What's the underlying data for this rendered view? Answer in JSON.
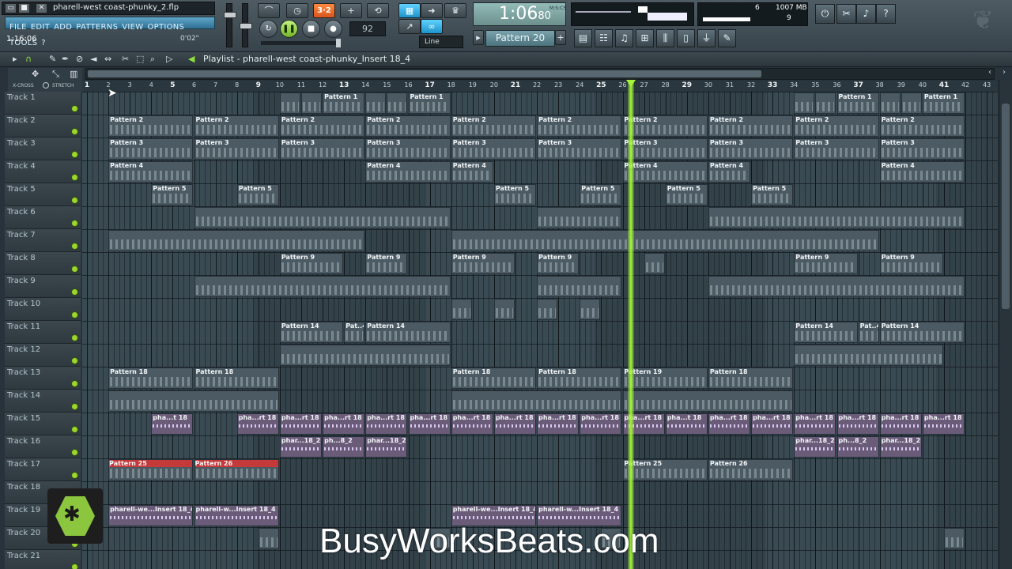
{
  "window": {
    "project_title": "pharell-west coast-phunky_2.flp",
    "menu": [
      "FILE",
      "EDIT",
      "ADD",
      "PATTERNS",
      "VIEW",
      "OPTIONS",
      "TOOLS",
      "?"
    ],
    "time_position": "1:16:06",
    "time_elapsed": "0'02\""
  },
  "transport": {
    "pat_song_label": "",
    "tempo": "92.000",
    "tempo_display": "92",
    "time_display": "1:06",
    "time_display_sub": "80",
    "time_format_label": "M:S:CS",
    "snap_mode": "Line",
    "current_pattern": "Pattern 20",
    "cpu_value": "6",
    "memory_value": "1007 MB",
    "polyphony_value": "9"
  },
  "playlist": {
    "title": "Playlist - pharell-west coast-phunky_Insert 18_4",
    "xcross_label": "X-CROSS",
    "stretch_label": "STRETCH",
    "ruler": [
      "1",
      "2",
      "3",
      "4",
      "5",
      "6",
      "7",
      "8",
      "9",
      "10",
      "11",
      "12",
      "13",
      "14",
      "15",
      "16",
      "17",
      "18",
      "19",
      "20",
      "21",
      "22",
      "23",
      "24",
      "25",
      "26",
      "27",
      "28",
      "29",
      "30",
      "31",
      "32",
      "33",
      "34",
      "35",
      "36",
      "37",
      "38",
      "39",
      "40",
      "41",
      "42",
      "43"
    ],
    "tracks": [
      "Track 1",
      "Track 2",
      "Track 3",
      "Track 4",
      "Track 5",
      "Track 6",
      "Track 7",
      "Track 8",
      "Track 9",
      "Track 10",
      "Track 11",
      "Track 12",
      "Track 13",
      "Track 14",
      "Track 15",
      "Track 16",
      "Track 17",
      "Track 18",
      "Track 19",
      "Track 20",
      "Track 21"
    ],
    "clips": [
      {
        "track": 0,
        "start": 10,
        "len": 1,
        "label": ""
      },
      {
        "track": 0,
        "start": 11,
        "len": 1,
        "label": ""
      },
      {
        "track": 0,
        "start": 12,
        "len": 2,
        "label": "Pattern 1"
      },
      {
        "track": 0,
        "start": 14,
        "len": 1,
        "label": ""
      },
      {
        "track": 0,
        "start": 15,
        "len": 1,
        "label": ""
      },
      {
        "track": 0,
        "start": 16,
        "len": 2,
        "label": "Pattern 1"
      },
      {
        "track": 0,
        "start": 34,
        "len": 1,
        "label": ""
      },
      {
        "track": 0,
        "start": 35,
        "len": 1,
        "label": ""
      },
      {
        "track": 0,
        "start": 36,
        "len": 2,
        "label": "Pattern 1"
      },
      {
        "track": 0,
        "start": 38,
        "len": 1,
        "label": ""
      },
      {
        "track": 0,
        "start": 39,
        "len": 1,
        "label": ""
      },
      {
        "track": 0,
        "start": 40,
        "len": 2,
        "label": "Pattern 1"
      },
      {
        "track": 1,
        "start": 2,
        "len": 4,
        "label": "Pattern 2"
      },
      {
        "track": 1,
        "start": 6,
        "len": 4,
        "label": "Pattern 2"
      },
      {
        "track": 1,
        "start": 10,
        "len": 4,
        "label": "Pattern 2"
      },
      {
        "track": 1,
        "start": 14,
        "len": 4,
        "label": "Pattern 2"
      },
      {
        "track": 1,
        "start": 18,
        "len": 4,
        "label": "Pattern 2"
      },
      {
        "track": 1,
        "start": 22,
        "len": 4,
        "label": "Pattern 2"
      },
      {
        "track": 1,
        "start": 26,
        "len": 4,
        "label": "Pattern 2"
      },
      {
        "track": 1,
        "start": 30,
        "len": 4,
        "label": "Pattern 2"
      },
      {
        "track": 1,
        "start": 34,
        "len": 4,
        "label": "Pattern 2"
      },
      {
        "track": 1,
        "start": 38,
        "len": 4,
        "label": "Pattern 2"
      },
      {
        "track": 2,
        "start": 2,
        "len": 4,
        "label": "Pattern 3"
      },
      {
        "track": 2,
        "start": 6,
        "len": 4,
        "label": "Pattern 3"
      },
      {
        "track": 2,
        "start": 10,
        "len": 4,
        "label": "Pattern 3"
      },
      {
        "track": 2,
        "start": 14,
        "len": 4,
        "label": "Pattern 3"
      },
      {
        "track": 2,
        "start": 18,
        "len": 4,
        "label": "Pattern 3"
      },
      {
        "track": 2,
        "start": 22,
        "len": 4,
        "label": "Pattern 3"
      },
      {
        "track": 2,
        "start": 26,
        "len": 4,
        "label": "Pattern 3"
      },
      {
        "track": 2,
        "start": 30,
        "len": 4,
        "label": "Pattern 3"
      },
      {
        "track": 2,
        "start": 34,
        "len": 4,
        "label": "Pattern 3"
      },
      {
        "track": 2,
        "start": 38,
        "len": 4,
        "label": "Pattern 3"
      },
      {
        "track": 3,
        "start": 2,
        "len": 4,
        "label": "Pattern 4"
      },
      {
        "track": 3,
        "start": 14,
        "len": 4,
        "label": "Pattern 4"
      },
      {
        "track": 3,
        "start": 18,
        "len": 2,
        "label": "Pattern 4"
      },
      {
        "track": 3,
        "start": 26,
        "len": 4,
        "label": "Pattern 4"
      },
      {
        "track": 3,
        "start": 30,
        "len": 2,
        "label": "Pattern 4"
      },
      {
        "track": 3,
        "start": 38,
        "len": 4,
        "label": "Pattern 4"
      },
      {
        "track": 4,
        "start": 4,
        "len": 2,
        "label": "Pattern 5"
      },
      {
        "track": 4,
        "start": 8,
        "len": 2,
        "label": "Pattern 5"
      },
      {
        "track": 4,
        "start": 20,
        "len": 2,
        "label": "Pattern 5"
      },
      {
        "track": 4,
        "start": 24,
        "len": 2,
        "label": "Pattern 5"
      },
      {
        "track": 4,
        "start": 28,
        "len": 2,
        "label": "Pattern 5"
      },
      {
        "track": 4,
        "start": 32,
        "len": 2,
        "label": "Pattern 5"
      },
      {
        "track": 5,
        "start": 6,
        "len": 12,
        "label": ""
      },
      {
        "track": 5,
        "start": 22,
        "len": 4,
        "label": ""
      },
      {
        "track": 5,
        "start": 30,
        "len": 12,
        "label": ""
      },
      {
        "track": 6,
        "start": 2,
        "len": 12,
        "label": ""
      },
      {
        "track": 6,
        "start": 18,
        "len": 20,
        "label": ""
      },
      {
        "track": 7,
        "start": 10,
        "len": 3,
        "label": "Pattern 9"
      },
      {
        "track": 7,
        "start": 14,
        "len": 2,
        "label": "Pattern 9"
      },
      {
        "track": 7,
        "start": 18,
        "len": 3,
        "label": "Pattern 9"
      },
      {
        "track": 7,
        "start": 22,
        "len": 2,
        "label": "Pattern 9"
      },
      {
        "track": 7,
        "start": 27,
        "len": 1,
        "label": ""
      },
      {
        "track": 7,
        "start": 34,
        "len": 3,
        "label": "Pattern 9"
      },
      {
        "track": 7,
        "start": 38,
        "len": 3,
        "label": "Pattern 9"
      },
      {
        "track": 8,
        "start": 6,
        "len": 12,
        "label": ""
      },
      {
        "track": 8,
        "start": 22,
        "len": 4,
        "label": ""
      },
      {
        "track": 8,
        "start": 30,
        "len": 12,
        "label": ""
      },
      {
        "track": 9,
        "start": 18,
        "len": 1,
        "label": ""
      },
      {
        "track": 9,
        "start": 20,
        "len": 1,
        "label": ""
      },
      {
        "track": 9,
        "start": 22,
        "len": 1,
        "label": ""
      },
      {
        "track": 9,
        "start": 24,
        "len": 1,
        "label": ""
      },
      {
        "track": 10,
        "start": 10,
        "len": 3,
        "label": "Pattern 14"
      },
      {
        "track": 10,
        "start": 13,
        "len": 1,
        "label": "Pat..4"
      },
      {
        "track": 10,
        "start": 14,
        "len": 4,
        "label": "Pattern 14"
      },
      {
        "track": 10,
        "start": 34,
        "len": 3,
        "label": "Pattern 14"
      },
      {
        "track": 10,
        "start": 37,
        "len": 1,
        "label": "Pat..4"
      },
      {
        "track": 10,
        "start": 38,
        "len": 4,
        "label": "Pattern 14"
      },
      {
        "track": 11,
        "start": 10,
        "len": 8,
        "label": ""
      },
      {
        "track": 11,
        "start": 34,
        "len": 7,
        "label": ""
      },
      {
        "track": 12,
        "start": 2,
        "len": 4,
        "label": "Pattern 18"
      },
      {
        "track": 12,
        "start": 6,
        "len": 4,
        "label": "Pattern 18"
      },
      {
        "track": 12,
        "start": 18,
        "len": 4,
        "label": "Pattern 18"
      },
      {
        "track": 12,
        "start": 22,
        "len": 4,
        "label": "Pattern 18"
      },
      {
        "track": 12,
        "start": 26,
        "len": 4,
        "label": "Pattern 19"
      },
      {
        "track": 12,
        "start": 30,
        "len": 4,
        "label": "Pattern 18"
      },
      {
        "track": 13,
        "start": 2,
        "len": 8,
        "label": ""
      },
      {
        "track": 13,
        "start": 18,
        "len": 8,
        "label": ""
      },
      {
        "track": 13,
        "start": 26,
        "len": 8,
        "label": ""
      },
      {
        "track": 14,
        "start": 4,
        "len": 2,
        "label": "pha...t 18",
        "audio": true
      },
      {
        "track": 14,
        "start": 8,
        "len": 2,
        "label": "pha...rt 18",
        "audio": true
      },
      {
        "track": 14,
        "start": 10,
        "len": 2,
        "label": "pha...rt 18",
        "audio": true
      },
      {
        "track": 14,
        "start": 12,
        "len": 2,
        "label": "pha...rt 18",
        "audio": true
      },
      {
        "track": 14,
        "start": 14,
        "len": 2,
        "label": "pha...rt 18",
        "audio": true
      },
      {
        "track": 14,
        "start": 16,
        "len": 2,
        "label": "pha...rt 18",
        "audio": true
      },
      {
        "track": 14,
        "start": 18,
        "len": 2,
        "label": "pha...rt 18",
        "audio": true
      },
      {
        "track": 14,
        "start": 20,
        "len": 2,
        "label": "pha...rt 18",
        "audio": true
      },
      {
        "track": 14,
        "start": 22,
        "len": 2,
        "label": "pha...rt 18",
        "audio": true
      },
      {
        "track": 14,
        "start": 24,
        "len": 2,
        "label": "pha...rt 18",
        "audio": true
      },
      {
        "track": 14,
        "start": 26,
        "len": 2,
        "label": "pha...rt 18",
        "audio": true
      },
      {
        "track": 14,
        "start": 28,
        "len": 2,
        "label": "pha...t 18",
        "audio": true
      },
      {
        "track": 14,
        "start": 30,
        "len": 2,
        "label": "pha...rt 18",
        "audio": true
      },
      {
        "track": 14,
        "start": 32,
        "len": 2,
        "label": "pha...rt 18",
        "audio": true
      },
      {
        "track": 14,
        "start": 34,
        "len": 2,
        "label": "pha...rt 18",
        "audio": true
      },
      {
        "track": 14,
        "start": 36,
        "len": 2,
        "label": "pha...rt 18",
        "audio": true
      },
      {
        "track": 14,
        "start": 38,
        "len": 2,
        "label": "pha...rt 18",
        "audio": true
      },
      {
        "track": 14,
        "start": 40,
        "len": 2,
        "label": "pha...rt 18",
        "audio": true
      },
      {
        "track": 15,
        "start": 10,
        "len": 2,
        "label": "phar...18_2",
        "audio": true
      },
      {
        "track": 15,
        "start": 12,
        "len": 2,
        "label": "ph...8_2",
        "audio": true
      },
      {
        "track": 15,
        "start": 14,
        "len": 2,
        "label": "phar...18_2",
        "audio": true
      },
      {
        "track": 15,
        "start": 34,
        "len": 2,
        "label": "phar...18_2",
        "audio": true
      },
      {
        "track": 15,
        "start": 36,
        "len": 2,
        "label": "ph...8_2",
        "audio": true
      },
      {
        "track": 15,
        "start": 38,
        "len": 2,
        "label": "phar...18_2",
        "audio": true
      },
      {
        "track": 16,
        "start": 2,
        "len": 4,
        "label": "Pattern 25",
        "red": true
      },
      {
        "track": 16,
        "start": 6,
        "len": 4,
        "label": "Pattern 26",
        "red": true
      },
      {
        "track": 16,
        "start": 26,
        "len": 4,
        "label": "Pattern 25"
      },
      {
        "track": 16,
        "start": 30,
        "len": 4,
        "label": "Pattern 26"
      },
      {
        "track": 18,
        "start": 2,
        "len": 4,
        "label": "pharell-we...Insert 18_4",
        "audio": true
      },
      {
        "track": 18,
        "start": 6,
        "len": 4,
        "label": "pharell-w...Insert 18_4",
        "audio": true
      },
      {
        "track": 18,
        "start": 18,
        "len": 4,
        "label": "pharell-we...Insert 18_4",
        "audio": true
      },
      {
        "track": 18,
        "start": 22,
        "len": 4,
        "label": "pharell-w...Insert 18_4",
        "audio": true
      },
      {
        "track": 19,
        "start": 9,
        "len": 1,
        "label": ""
      },
      {
        "track": 19,
        "start": 17,
        "len": 1,
        "label": ""
      },
      {
        "track": 19,
        "start": 25,
        "len": 1,
        "label": ""
      },
      {
        "track": 19,
        "start": 41,
        "len": 1,
        "label": ""
      }
    ],
    "playhead_bar": 26.4
  },
  "watermark": "BusyWorksBeats.com",
  "colors": {
    "accent": "#a6f437",
    "menu": "#3b8cb5",
    "red_clip": "#c43a3a",
    "audio_clip": "#6a5b79"
  }
}
